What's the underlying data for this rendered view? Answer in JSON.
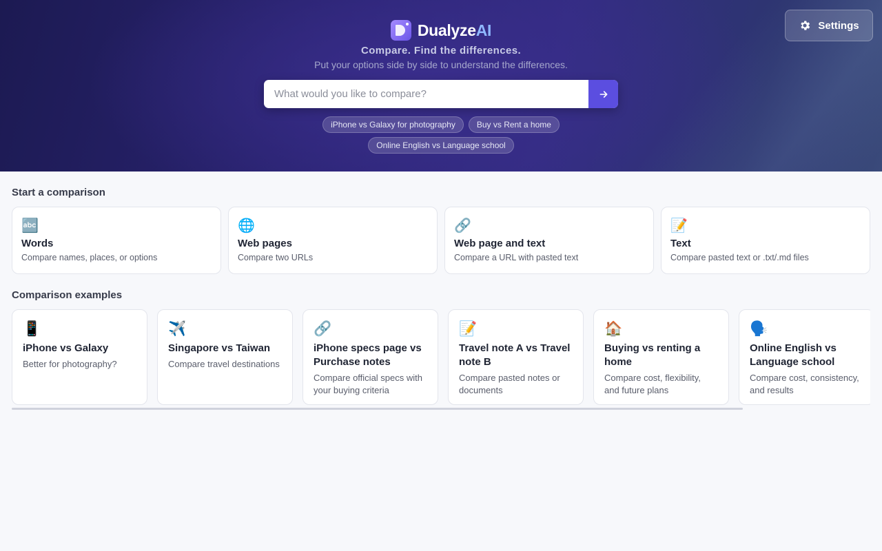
{
  "header": {
    "settings_label": "Settings",
    "brand_name": "Dualyze",
    "brand_accent": "AI",
    "tagline": "Compare. Find the differences.",
    "subtagline": "Put your options side by side to understand the differences.",
    "search_placeholder": "What would you like to compare?",
    "chips": [
      "iPhone vs Galaxy for photography",
      "Buy vs Rent a home",
      "Online English vs Language school"
    ]
  },
  "start": {
    "title": "Start a comparison",
    "cards": [
      {
        "icon": "🔤",
        "title": "Words",
        "desc": "Compare names, places, or options"
      },
      {
        "icon": "🌐",
        "title": "Web pages",
        "desc": "Compare two URLs"
      },
      {
        "icon": "🔗",
        "title": "Web page and text",
        "desc": "Compare a URL with pasted text"
      },
      {
        "icon": "📝",
        "title": "Text",
        "desc": "Compare pasted text or .txt/.md files"
      }
    ]
  },
  "examples": {
    "title": "Comparison examples",
    "cards": [
      {
        "icon": "📱",
        "title": "iPhone vs Galaxy",
        "desc": "Better for photography?"
      },
      {
        "icon": "✈️",
        "title": "Singapore vs Taiwan",
        "desc": "Compare travel destinations"
      },
      {
        "icon": "🔗",
        "title": "iPhone specs page vs Purchase notes",
        "desc": "Compare official specs with your buying criteria"
      },
      {
        "icon": "📝",
        "title": "Travel note A vs Travel note B",
        "desc": "Compare pasted notes or documents"
      },
      {
        "icon": "🏠",
        "title": "Buying vs renting a home",
        "desc": "Compare cost, flexibility, and future plans"
      },
      {
        "icon": "🗣️",
        "title": "Online English vs Language school",
        "desc": "Compare cost, consistency, and results"
      }
    ]
  },
  "colors": {
    "accent": "#5b4ee0",
    "brand_accent": "#8fb8ff",
    "hero_dark": "#1c1a52"
  }
}
